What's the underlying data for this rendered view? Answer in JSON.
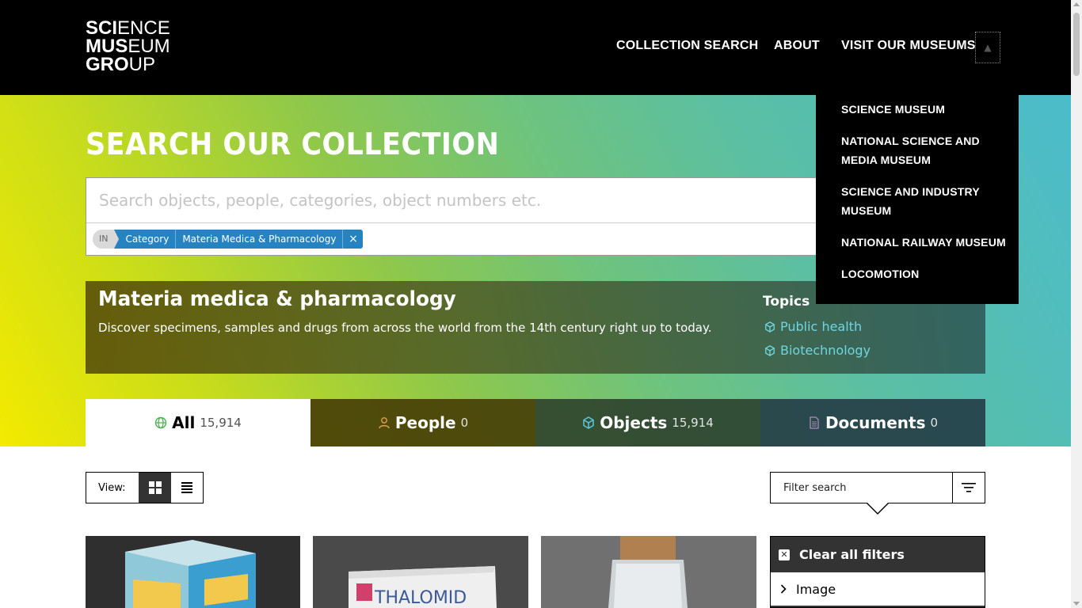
{
  "header": {
    "logo_lines": [
      {
        "bold": "SCI",
        "light": "ENCE"
      },
      {
        "bold": "MUS",
        "light": "EUM"
      },
      {
        "bold": "GRO",
        "light": "UP"
      }
    ],
    "nav": {
      "collection_search": "COLLECTION SEARCH",
      "about": "ABOUT",
      "visit": "VISIT OUR MUSEUMS",
      "toggle_glyph": "▲"
    }
  },
  "dropdown": {
    "items": [
      "SCIENCE MUSEUM",
      "NATIONAL SCIENCE AND MEDIA MUSEUM",
      "SCIENCE AND INDUSTRY MUSEUM",
      "NATIONAL RAILWAY MUSEUM",
      "LOCOMOTION"
    ]
  },
  "hero": {
    "title": "SEARCH OUR COLLECTION",
    "search_placeholder": "Search objects, people, categories, object numbers etc.",
    "chips": {
      "in": "IN",
      "type": "Category",
      "value": "Materia Medica & Pharmacology",
      "remove": "×"
    }
  },
  "category": {
    "title": "Materia medica & pharmacology",
    "description": "Discover specimens, samples and drugs from across the world from the 14th century right up to today.",
    "topics_title": "Topics",
    "topics": [
      "Public health",
      "Biotechnology"
    ]
  },
  "tabs": [
    {
      "label": "All",
      "count": "15,914"
    },
    {
      "label": "People",
      "count": "0"
    },
    {
      "label": "Objects",
      "count": "15,914"
    },
    {
      "label": "Documents",
      "count": "0"
    }
  ],
  "toolbar": {
    "view_label": "View:",
    "filter_placeholder": "Filter search",
    "clear_filters": "Clear all filters",
    "image_filter": "Image"
  },
  "colors": {
    "header_bg": "#000000",
    "chip_blue": "#2683c2",
    "topic_link": "#6fd6e0",
    "people_icon": "#e0a050",
    "objects_icon": "#5bc8dc",
    "documents_icon": "#b08ab8",
    "all_icon": "#4caf50"
  }
}
